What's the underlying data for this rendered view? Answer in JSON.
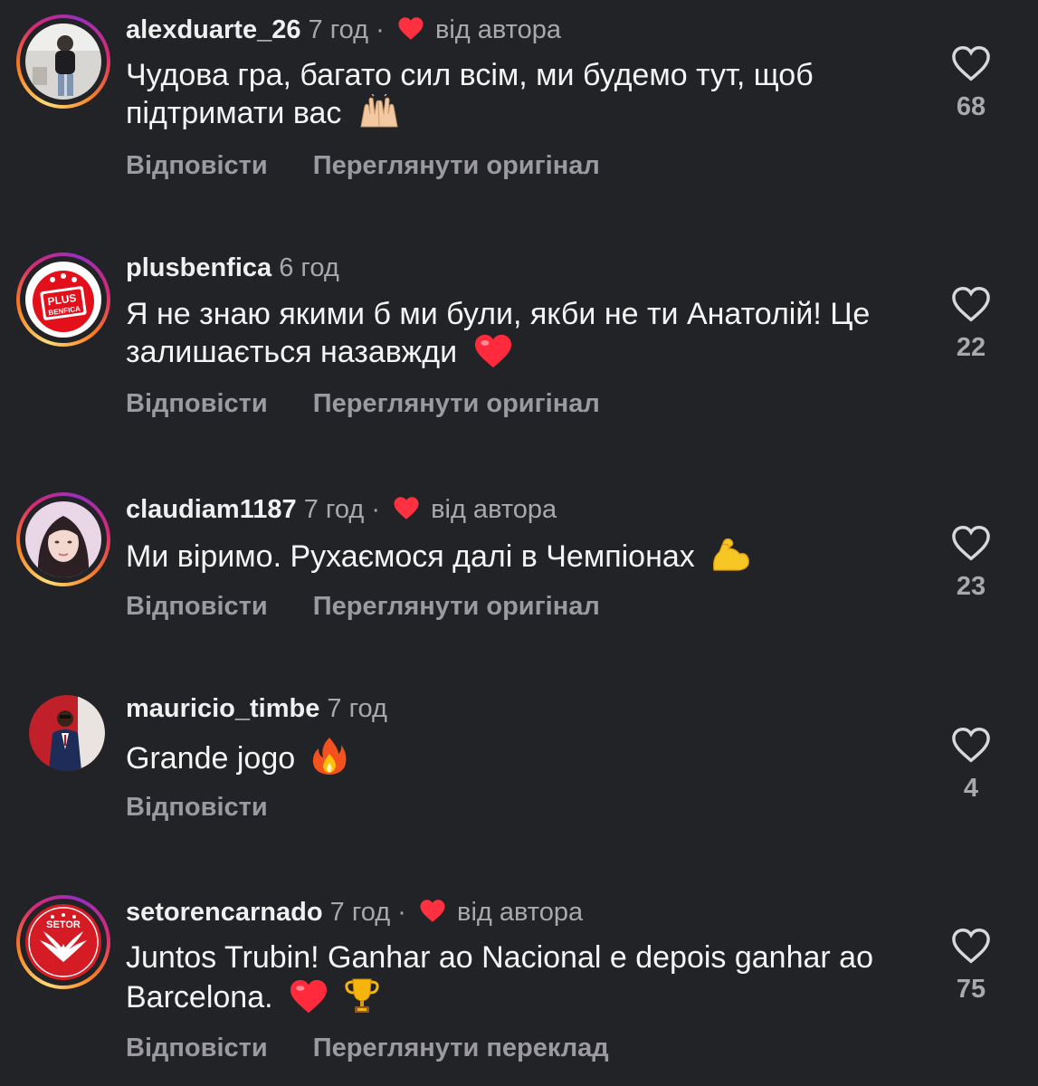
{
  "comments": [
    {
      "username": "alexduarte_26",
      "time": "7 год",
      "separator": "·",
      "author_tag": "від автора",
      "text": "Чудова гра, багато сил всім, ми будемо тут, щоб підтримати вас",
      "emoji": "raising-hands",
      "reply_label": "Відповісти",
      "secondary_label": "Переглянути оригінал",
      "likes": "68",
      "avatar": "photo-person-standing",
      "story_ring": true
    },
    {
      "username": "plusbenfica",
      "time": "6 год",
      "text": "Я не знаю якими б ми були, якби не ти Анатолій! Це залишається назавжди",
      "emoji": "red-heart",
      "reply_label": "Відповісти",
      "secondary_label": "Переглянути оригінал",
      "likes": "22",
      "avatar": "plus-benfica-logo",
      "avatar_logo_line1": "PLUS",
      "avatar_logo_line2": "BENFICA",
      "story_ring": true
    },
    {
      "username": "claudiam1187",
      "time": "7 год",
      "separator": "·",
      "author_tag": "від автора",
      "text": "Ми віримо. Рухаємося далі в Чемпіонах",
      "emoji": "flexed-biceps",
      "reply_label": "Відповісти",
      "secondary_label": "Переглянути оригінал",
      "likes": "23",
      "avatar": "photo-woman-portrait",
      "story_ring": true
    },
    {
      "username": "mauricio_timbe",
      "time": "7 год",
      "text": "Grande jogo",
      "emoji": "fire",
      "reply_label": "Відповісти",
      "likes": "4",
      "avatar": "photo-man-in-suit",
      "story_ring": false
    },
    {
      "username": "setorencarnado",
      "time": "7 год",
      "separator": "·",
      "author_tag": "від автора",
      "text": "Juntos Trubin! Ganhar ao Nacional e depois ganhar ao Barcelona.",
      "emoji": "red-heart-trophy",
      "reply_label": "Відповісти",
      "secondary_label": "Переглянути переклад",
      "likes": "75",
      "avatar": "setor-encarnado-logo",
      "avatar_logo_text": "SETOR",
      "story_ring": true
    }
  ],
  "colors": {
    "background": "#222327",
    "text_primary": "#f5f5f5",
    "text_secondary": "#a8a8ad",
    "heart_red": "#ff3040",
    "benfica_red": "#e3101b"
  }
}
